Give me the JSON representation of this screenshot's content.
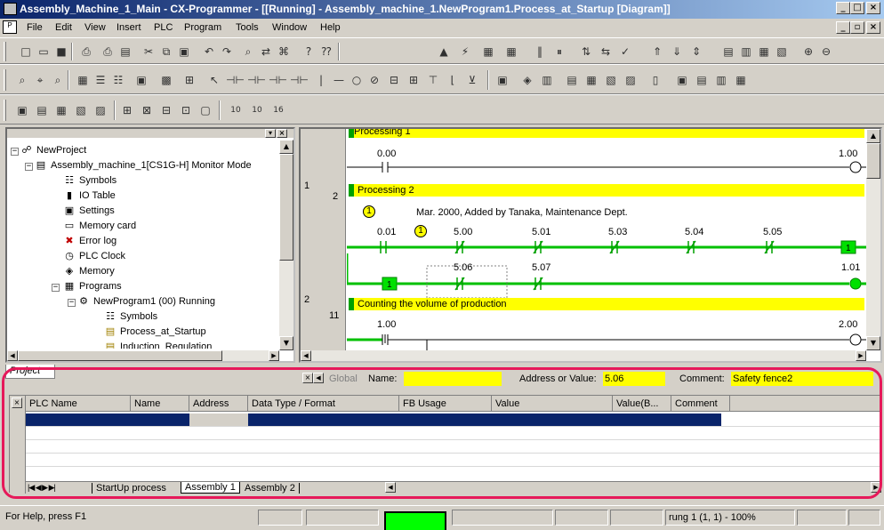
{
  "window": {
    "title": "Assembly_Machine_1_Main - CX-Programmer - [[Running] - Assembly_machine_1.NewProgram1.Process_at_Startup [Diagram]]",
    "minimize": "_",
    "maximize": "□",
    "close": "×"
  },
  "menu": [
    "File",
    "Edit",
    "View",
    "Insert",
    "PLC",
    "Program",
    "Tools",
    "Window",
    "Help"
  ],
  "project_tree": {
    "tab_label": "Project",
    "items": [
      {
        "label": "NewProject",
        "icon": "network-icon"
      },
      {
        "label": "Assembly_machine_1[CS1G-H] Monitor Mode",
        "icon": "plc-icon"
      },
      {
        "label": "Symbols",
        "icon": "symbols-icon"
      },
      {
        "label": "IO Table",
        "icon": "io-table-icon"
      },
      {
        "label": "Settings",
        "icon": "settings-icon"
      },
      {
        "label": "Memory card",
        "icon": "memory-card-icon"
      },
      {
        "label": "Error log",
        "icon": "error-log-icon"
      },
      {
        "label": "PLC Clock",
        "icon": "clock-icon"
      },
      {
        "label": "Memory",
        "icon": "memory-icon"
      },
      {
        "label": "Programs",
        "icon": "folder-icon"
      },
      {
        "label": "NewProgram1 (00) Running",
        "icon": "program-icon"
      },
      {
        "label": "Symbols",
        "icon": "symbols-icon"
      },
      {
        "label": "Process_at_Startup",
        "icon": "section-icon"
      },
      {
        "label": "Induction_Regulation",
        "icon": "section-icon"
      }
    ]
  },
  "diagram": {
    "rungs": [
      {
        "header": "Processing 1",
        "contact": "0.00",
        "coil": "1.00"
      },
      {
        "rung_no": "1",
        "step": "2",
        "header": "Processing 2",
        "comment_marker": "①",
        "comment": "Mar. 2000, Added by Tanaka, Maintenance Dept.",
        "row1": [
          "0.01",
          "①",
          "5.00",
          "5.01",
          "5.03",
          "5.04",
          "5.05"
        ],
        "row1_out": "1",
        "row2_in": "1",
        "row2": [
          "5.06",
          "5.07"
        ],
        "row2_coil": "1.01"
      },
      {
        "rung_no": "2",
        "step": "11",
        "header": "Counting the volume of production",
        "contact": "1.00",
        "coil": "2.00"
      }
    ]
  },
  "watch": {
    "global_label": "Global",
    "name_label": "Name:",
    "name_value": "",
    "address_label": "Address or Value:",
    "address_value": "5.06",
    "comment_label": "Comment:",
    "comment_value": "Safety fence2",
    "columns": [
      "PLC Name",
      "Name",
      "Address",
      "Data Type / Format",
      "FB Usage",
      "Value",
      "Value(B...",
      "Comment"
    ],
    "tabs": [
      "StartUp process",
      "Assembly 1",
      "Assembly 2"
    ]
  },
  "status": {
    "help": "For Help, press F1",
    "rung": "rung 1 (1, 1)  - 100%"
  }
}
